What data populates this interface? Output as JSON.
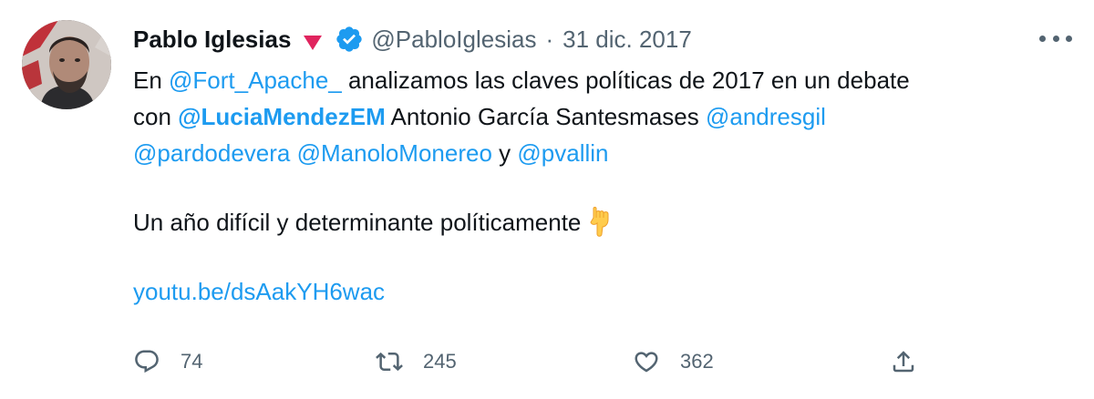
{
  "tweet": {
    "author_name": "Pablo Iglesias",
    "handle": "@PabloIglesias",
    "separator": "·",
    "date": "31 dic. 2017",
    "text": {
      "l1_a": "En ",
      "l1_mention": "@Fort_Apache_",
      "l1_b": " analizamos las claves políticas de 2017 en un debate",
      "l2_a": "con ",
      "l2_mention_bold": "@LuciaMendezEM",
      "l2_b": " Antonio García Santesmases ",
      "l2_mention": "@andresgil",
      "l3_mention1": "@pardodevera",
      "l3_space": " ",
      "l3_mention2": "@ManoloMonereo",
      "l3_and": " y ",
      "l3_mention3": "@pvallin",
      "l4": "Un año difícil y determinante políticamente",
      "link": "youtu.be/dsAakYH6wac"
    },
    "emoji_name": "backhand-index-pointing-down",
    "actions": {
      "reply_count": "74",
      "retweet_count": "245",
      "like_count": "362"
    },
    "icons": {
      "flag": "red-triangle-icon",
      "verified": "verified-badge-icon",
      "more": "more-options-icon",
      "reply": "reply-icon",
      "retweet": "retweet-icon",
      "like": "heart-icon",
      "share": "share-icon"
    },
    "colors": {
      "link": "#1d9bf0",
      "secondary_text": "#536471",
      "primary_text": "#0f1419",
      "flag": "#e0245e"
    }
  }
}
